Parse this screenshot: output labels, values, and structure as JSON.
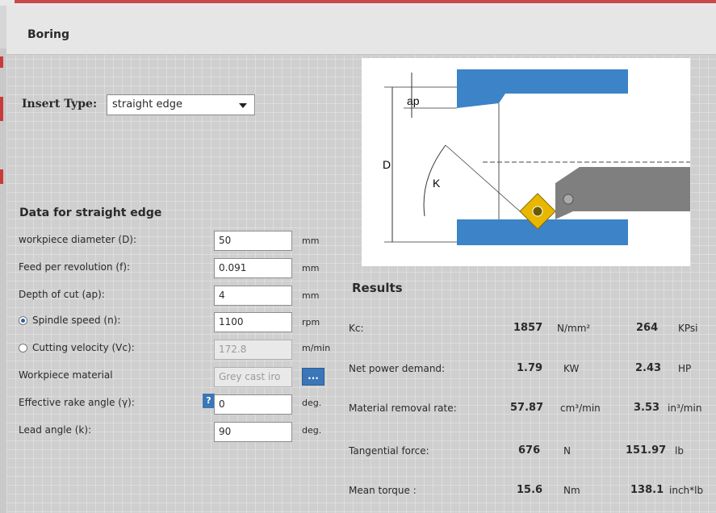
{
  "window": {
    "title": "Boring"
  },
  "insert": {
    "label": "Insert Type:",
    "selected": "straight edge"
  },
  "section_title": "Data for  straight edge",
  "fields": [
    {
      "label": "workpiece diameter (D):",
      "value": "50",
      "unit": "mm"
    },
    {
      "label": "Feed per revolution (f):",
      "value": "0.091",
      "unit": "mm"
    },
    {
      "label": "Depth of cut (ap):",
      "value": "4",
      "unit": "mm"
    },
    {
      "label": "Spindle speed (n):",
      "value": "1100",
      "unit": "rpm"
    },
    {
      "label": "Cutting velocity (Vc):",
      "value": "172.8",
      "unit": "m/min"
    },
    {
      "label": "Workpiece material",
      "value": "Grey cast iro",
      "button": "..."
    },
    {
      "label": "Effective rake angle (γ):",
      "value": "0",
      "unit": "deg.",
      "help": "?"
    },
    {
      "label": "Lead angle (k):",
      "value": "90",
      "unit": "deg."
    }
  ],
  "diagram": {
    "ap": "ap",
    "D": "D",
    "K": "K"
  },
  "results": {
    "title": "Results",
    "rows": [
      {
        "label": "Kc:",
        "v1": "1857",
        "u1": "N/mm²",
        "v2": "264",
        "u2": "KPsi"
      },
      {
        "label": "Net  power demand:",
        "v1": "1.79",
        "u1": "KW",
        "v2": "2.43",
        "u2": "HP"
      },
      {
        "label": "Material removal rate:",
        "v1": "57.87",
        "u1": "cm³/min",
        "v2": "3.53",
        "u2": "in³/min"
      },
      {
        "label": "Tangential force:",
        "v1": "676",
        "u1": "N",
        "v2": "151.97",
        "u2": "lb"
      },
      {
        "label": "Mean torque :",
        "v1": "15.6",
        "u1": "Nm",
        "v2": "138.1",
        "u2": "inch*lb"
      }
    ]
  },
  "colors": {
    "accent": "#3a76b8",
    "workpiece": "#3c83c8",
    "insert": "#e8b800"
  }
}
